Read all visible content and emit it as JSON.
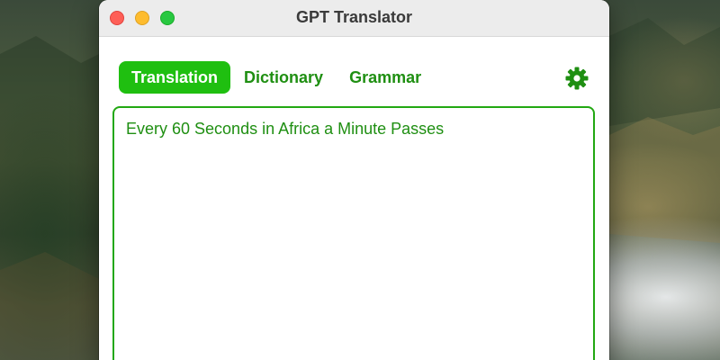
{
  "window": {
    "title": "GPT Translator"
  },
  "tabs": [
    {
      "label": "Translation",
      "active": true
    },
    {
      "label": "Dictionary",
      "active": false
    },
    {
      "label": "Grammar",
      "active": false
    }
  ],
  "settings": {
    "icon": "gear-icon"
  },
  "editor": {
    "text": "Every 60 Seconds in Africa a Minute Passes"
  },
  "colors": {
    "accent": "#1fbf10",
    "text_green": "#1f8f12",
    "border_green": "#22a812"
  }
}
